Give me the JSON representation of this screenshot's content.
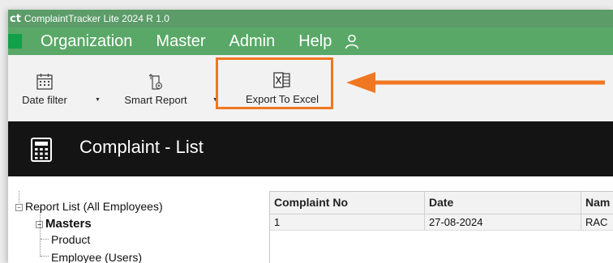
{
  "app": {
    "logo_text": "ct",
    "title": "ComplaintTracker Lite 2024 R 1.0"
  },
  "menu": {
    "items": [
      "Organization",
      "Master",
      "Admin",
      "Help"
    ],
    "user_icon": "user-icon"
  },
  "toolbar": {
    "date_filter": "Date filter",
    "smart_report": "Smart Report",
    "export_excel": "Export To Excel",
    "dropdown_glyph": "▼"
  },
  "header": {
    "title": "Complaint - List",
    "icon": "calculator-icon"
  },
  "tree": {
    "root": "Report List (All Employees)",
    "masters": "Masters",
    "children": [
      "Product",
      "Employee (Users)"
    ],
    "expand_glyph": "−"
  },
  "grid": {
    "columns": [
      "Complaint No",
      "Date",
      "Nam"
    ],
    "rows": [
      [
        "1",
        "27-08-2024",
        "RAC"
      ]
    ]
  },
  "colors": {
    "menu_bg": "#59a867",
    "title_bg": "#5b9c69",
    "highlight": "#f07722",
    "header_bg": "#141414"
  }
}
